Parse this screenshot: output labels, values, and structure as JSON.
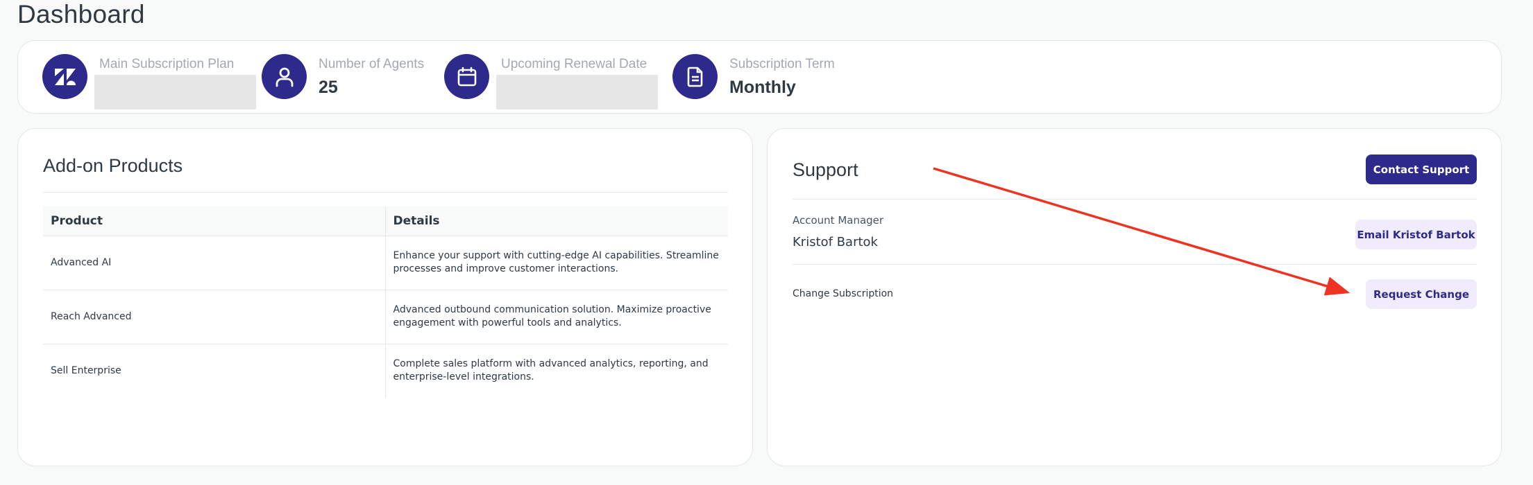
{
  "page": {
    "title": "Dashboard"
  },
  "summary": {
    "plan": {
      "label": "Main Subscription Plan",
      "icon": "zendesk-logo-icon"
    },
    "agents": {
      "label": "Number of Agents",
      "value": "25",
      "icon": "user-icon"
    },
    "renewal": {
      "label": "Upcoming Renewal Date",
      "icon": "calendar-icon"
    },
    "term": {
      "label": "Subscription Term",
      "value": "Monthly",
      "icon": "document-icon"
    }
  },
  "addons": {
    "title": "Add-on Products",
    "columns": [
      "Product",
      "Details"
    ],
    "rows": [
      {
        "product": "Advanced AI",
        "details": "Enhance your support with cutting-edge AI capabilities. Streamline processes and improve customer interactions."
      },
      {
        "product": "Reach Advanced",
        "details": "Advanced outbound communication solution. Maximize proactive engagement with powerful tools and analytics."
      },
      {
        "product": "Sell Enterprise",
        "details": "Complete sales platform with advanced analytics, reporting, and enterprise-level integrations."
      }
    ]
  },
  "support": {
    "title": "Support",
    "contact_button": "Contact Support",
    "account_manager_label": "Account Manager",
    "account_manager_name": "Kristof Bartok",
    "email_button": "Email Kristof Bartok",
    "change_label": "Change Subscription",
    "request_button": "Request Change"
  },
  "colors": {
    "brand": "#2e2a8c",
    "soft_button": "#f1ecfd",
    "annotation_arrow": "#ee3322"
  }
}
